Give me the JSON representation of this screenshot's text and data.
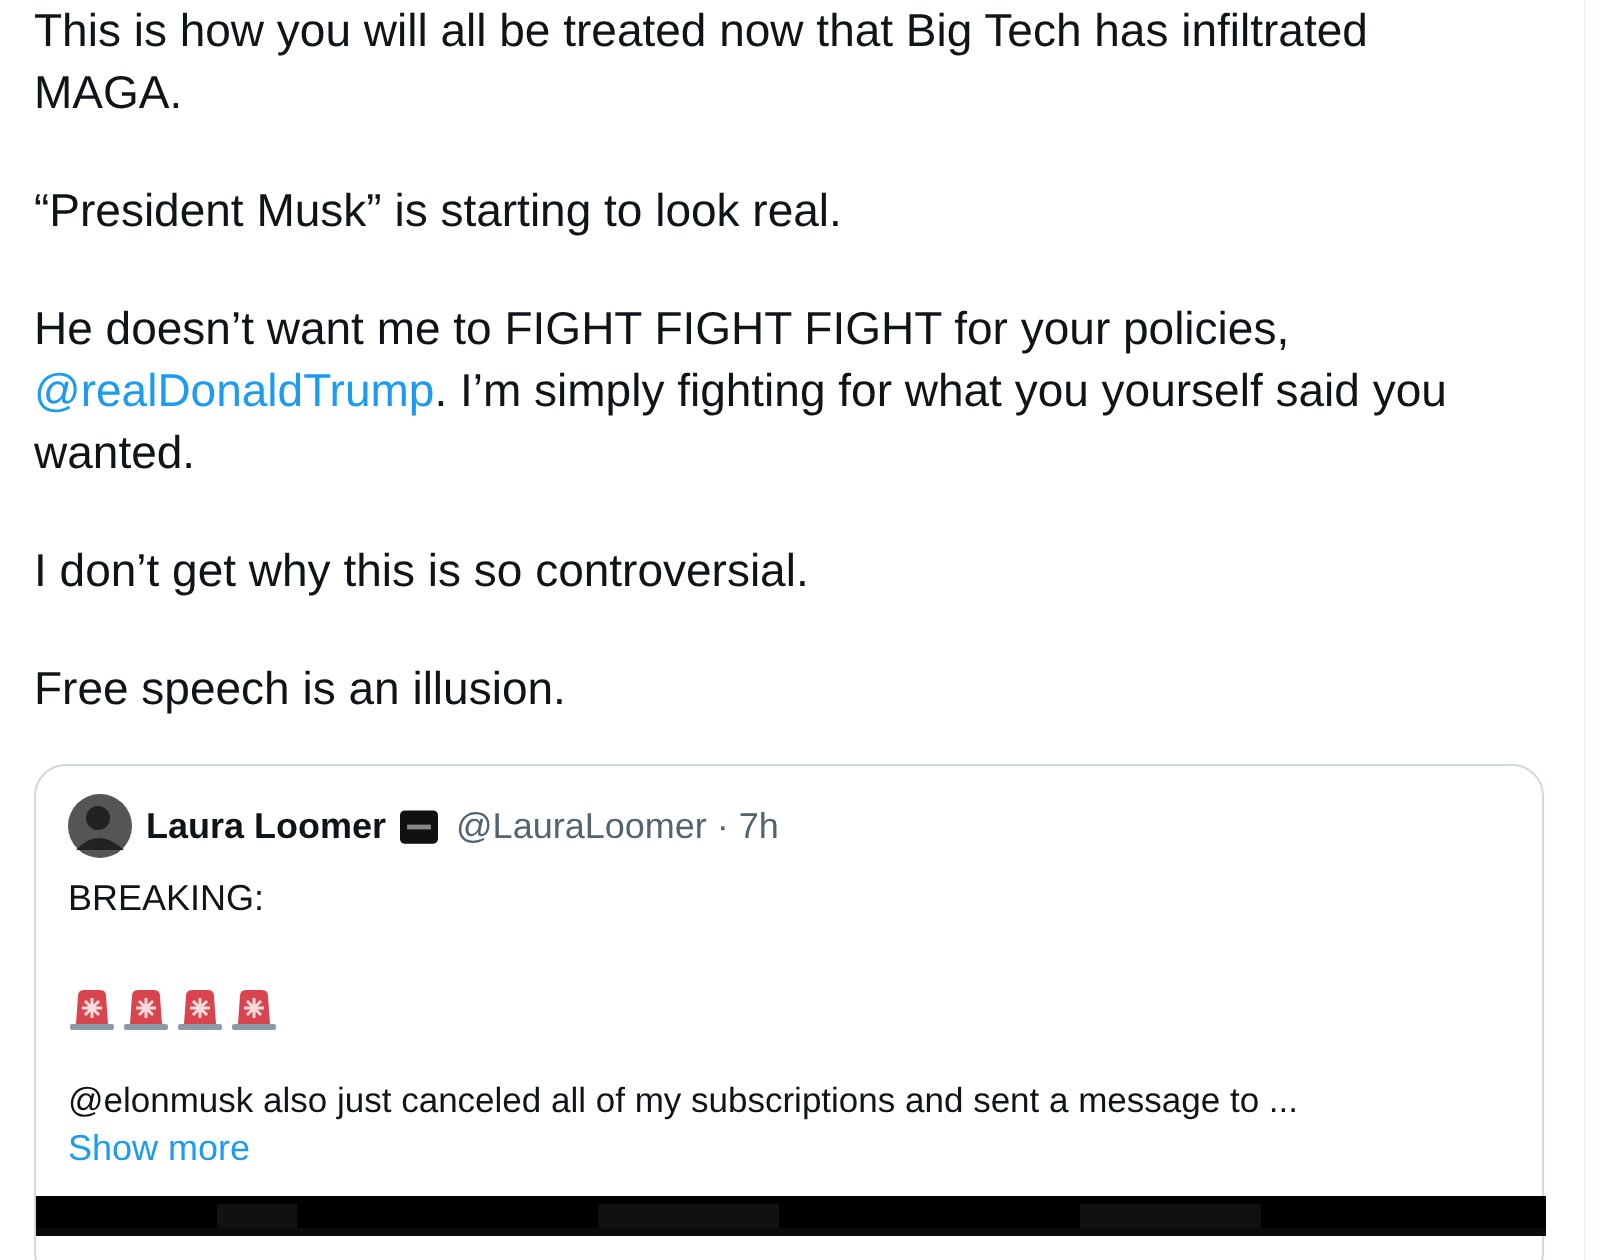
{
  "tweet": {
    "paragraphs": [
      [
        {
          "text": "This is how you will all be treated now that Big Tech has infiltrated MAGA."
        }
      ],
      [
        {
          "text": "“President Musk” is starting to look real."
        }
      ],
      [
        {
          "text": "He doesn’t want me to FIGHT FIGHT FIGHT for your policies, "
        },
        {
          "text": "@realDonaldTrump",
          "link": true
        },
        {
          "text": ". I’m simply fighting for what you yourself said you wanted."
        }
      ],
      [
        {
          "text": "I don’t get why this is so controversial."
        }
      ],
      [
        {
          "text": "Free speech is an illusion."
        }
      ]
    ]
  },
  "quoted_tweet": {
    "name": "Laura Loomer",
    "handle": "@LauraLoomer",
    "time": "· 7h",
    "lines": [
      "BREAKING:"
    ],
    "emojis": [
      {
        "kind": "siren"
      },
      {
        "kind": "siren"
      },
      {
        "kind": "siren"
      },
      {
        "kind": "siren"
      }
    ],
    "body": "@elonmusk also just canceled all of my subscriptions and sent a message to ...",
    "show_more": "Show more"
  }
}
